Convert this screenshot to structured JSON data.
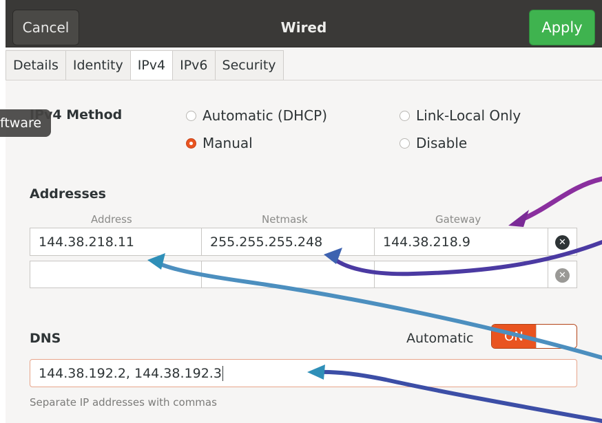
{
  "header": {
    "cancel_label": "Cancel",
    "title": "Wired",
    "apply_label": "Apply"
  },
  "tabs": [
    {
      "label": "Details"
    },
    {
      "label": "Identity"
    },
    {
      "label": "IPv4",
      "active": true
    },
    {
      "label": "IPv6"
    },
    {
      "label": "Security"
    }
  ],
  "tooltip": {
    "text": "ftware"
  },
  "ipv4_method": {
    "label": "IPv4 Method",
    "options": {
      "automatic_dhcp": "Automatic (DHCP)",
      "link_local_only": "Link-Local Only",
      "manual": "Manual",
      "disable": "Disable"
    },
    "selected": "Manual"
  },
  "addresses": {
    "label": "Addresses",
    "columns": [
      "Address",
      "Netmask",
      "Gateway"
    ],
    "rows": [
      {
        "address": "144.38.218.11",
        "netmask": "255.255.255.248",
        "gateway": "144.38.218.9"
      },
      {
        "address": "",
        "netmask": "",
        "gateway": ""
      }
    ]
  },
  "dns": {
    "label": "DNS",
    "automatic_label": "Automatic",
    "switch_label": "ON",
    "value": "144.38.192.2, 144.38.192.3",
    "hint": "Separate IP addresses with commas"
  },
  "colors": {
    "accent": "#e95420",
    "apply": "#3fb34f",
    "header": "#3a3937"
  },
  "icons": {
    "row_delete": "circle-x-icon"
  }
}
